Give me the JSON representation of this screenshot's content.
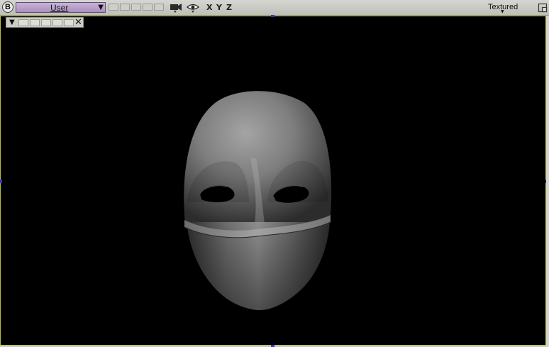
{
  "header": {
    "logo_label": "B",
    "view_menu_label": "User",
    "axes": [
      "X",
      "Y",
      "Z"
    ],
    "shading_label": "Textured",
    "icons": [
      "blender-logo-icon",
      "camera-icon",
      "eye-icon",
      "maximize-icon"
    ]
  },
  "viewport": {
    "background_color": "#000000",
    "border_color": "#bcbf3a",
    "model": "mask",
    "icons": [
      "dropdown-arrow-icon",
      "close-icon"
    ]
  },
  "colors": {
    "chrome": "#c9c9c4",
    "view_selector": "#b8a0cf",
    "handle": "#3535c8"
  }
}
